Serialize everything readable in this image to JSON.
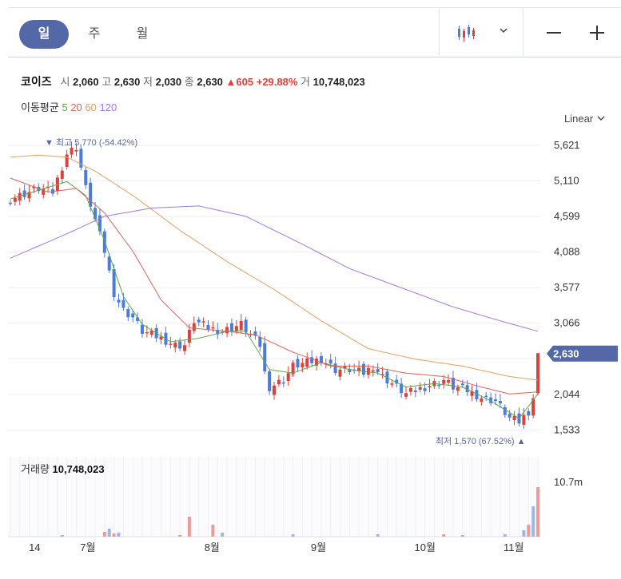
{
  "periods": [
    {
      "label": "일",
      "active": true
    },
    {
      "label": "주",
      "active": false
    },
    {
      "label": "월",
      "active": false
    }
  ],
  "toolbar": {
    "chart_type_icon": "candlestick-icon",
    "dropdown_icon": "chevron-down-icon",
    "zoom_out_icon": "minus-icon",
    "zoom_in_icon": "plus-icon"
  },
  "stock": {
    "name": "코이즈",
    "open_label": "시",
    "open": "2,060",
    "high_label": "고",
    "high": "2,630",
    "low_label": "저",
    "low": "2,030",
    "close_label": "종",
    "close": "2,630",
    "change": "▲605",
    "change_pct": "+29.88%",
    "volume_label": "거",
    "volume": "10,748,023"
  },
  "ma": {
    "label": "이동평균",
    "periods": [
      "5",
      "20",
      "60",
      "120"
    ],
    "colors": [
      "#5aa845",
      "#e0635a",
      "#e6a060",
      "#a577e6"
    ]
  },
  "scale": {
    "label": "Linear",
    "icon": "chevron-down-icon"
  },
  "volume_panel": {
    "label": "거래량",
    "value": "10,748,023",
    "axis_label": "10.7m"
  },
  "colors": {
    "up": "#e0403b",
    "down": "#4b7be0",
    "accent": "#5467a6",
    "grid": "#eeeeee"
  },
  "chart_data": {
    "type": "candlestick",
    "y_ticks": [
      5621,
      5110,
      4599,
      4088,
      3577,
      3066,
      2555,
      2044,
      1533
    ],
    "y_tick_labels": [
      "5,621",
      "5,110",
      "4,599",
      "4,088",
      "3,577",
      "3,066",
      "",
      "2,044",
      "1,533"
    ],
    "ylim": [
      1400,
      5700
    ],
    "current_price": 2630,
    "current_price_label": "2,630",
    "high_annotation": {
      "text": "최고 5,770 (-54.42%)",
      "value": 5770
    },
    "low_annotation": {
      "text": "최저 1,570 (67.52%)",
      "value": 1570
    },
    "x_labels": [
      "14",
      "7월",
      "8월",
      "9월",
      "10월",
      "11월"
    ],
    "close_anchors": [
      [
        0,
        4850
      ],
      [
        6,
        5000
      ],
      [
        9,
        4950
      ],
      [
        12,
        5500
      ],
      [
        14,
        5600
      ],
      [
        16,
        5000
      ],
      [
        18,
        4550
      ],
      [
        20,
        4100
      ],
      [
        22,
        3500
      ],
      [
        24,
        3250
      ],
      [
        26,
        3150
      ],
      [
        28,
        2950
      ],
      [
        32,
        2850
      ],
      [
        35,
        2750
      ],
      [
        37,
        2750
      ],
      [
        39,
        3100
      ],
      [
        42,
        3000
      ],
      [
        45,
        2950
      ],
      [
        49,
        3050
      ],
      [
        51,
        2900
      ],
      [
        53,
        2750
      ],
      [
        54,
        2350
      ],
      [
        55,
        2150
      ],
      [
        58,
        2250
      ],
      [
        60,
        2450
      ],
      [
        63,
        2500
      ],
      [
        66,
        2550
      ],
      [
        69,
        2400
      ],
      [
        72,
        2400
      ],
      [
        75,
        2350
      ],
      [
        77,
        2450
      ],
      [
        79,
        2300
      ],
      [
        81,
        2200
      ],
      [
        84,
        2050
      ],
      [
        86,
        2100
      ],
      [
        88,
        2150
      ],
      [
        90,
        2200
      ],
      [
        92,
        2250
      ],
      [
        94,
        2150
      ],
      [
        97,
        2100
      ],
      [
        100,
        2000
      ],
      [
        103,
        1950
      ],
      [
        106,
        1700
      ],
      [
        108,
        1650
      ],
      [
        110,
        1800
      ],
      [
        111,
        2000
      ],
      [
        112,
        2600
      ]
    ],
    "ma": {
      "5": [
        [
          0,
          4850
        ],
        [
          12,
          5100
        ],
        [
          16,
          4900
        ],
        [
          20,
          4250
        ],
        [
          24,
          3450
        ],
        [
          28,
          3050
        ],
        [
          34,
          2800
        ],
        [
          40,
          2850
        ],
        [
          46,
          2950
        ],
        [
          50,
          2950
        ],
        [
          55,
          2400
        ],
        [
          60,
          2350
        ],
        [
          66,
          2500
        ],
        [
          72,
          2400
        ],
        [
          78,
          2350
        ],
        [
          84,
          2150
        ],
        [
          90,
          2200
        ],
        [
          96,
          2150
        ],
        [
          102,
          1950
        ],
        [
          108,
          1700
        ],
        [
          112,
          2050
        ]
      ],
      "20": [
        [
          0,
          5150
        ],
        [
          8,
          4950
        ],
        [
          14,
          5000
        ],
        [
          20,
          4650
        ],
        [
          26,
          4100
        ],
        [
          32,
          3400
        ],
        [
          38,
          3000
        ],
        [
          46,
          2950
        ],
        [
          52,
          2900
        ],
        [
          60,
          2650
        ],
        [
          68,
          2450
        ],
        [
          76,
          2450
        ],
        [
          84,
          2350
        ],
        [
          92,
          2300
        ],
        [
          100,
          2150
        ],
        [
          106,
          2050
        ],
        [
          112,
          2080
        ]
      ],
      "60": [
        [
          0,
          5450
        ],
        [
          6,
          5480
        ],
        [
          12,
          5450
        ],
        [
          18,
          5250
        ],
        [
          26,
          4900
        ],
        [
          36,
          4400
        ],
        [
          46,
          3950
        ],
        [
          56,
          3550
        ],
        [
          66,
          3100
        ],
        [
          76,
          2700
        ],
        [
          86,
          2550
        ],
        [
          96,
          2450
        ],
        [
          106,
          2300
        ],
        [
          112,
          2250
        ]
      ],
      "120": [
        [
          0,
          4000
        ],
        [
          12,
          4350
        ],
        [
          20,
          4600
        ],
        [
          30,
          4720
        ],
        [
          40,
          4750
        ],
        [
          50,
          4600
        ],
        [
          62,
          4200
        ],
        [
          72,
          3850
        ],
        [
          82,
          3600
        ],
        [
          94,
          3300
        ],
        [
          104,
          3100
        ],
        [
          112,
          2950
        ]
      ]
    },
    "volume_bars": [
      [
        11,
        0.02,
        "down"
      ],
      [
        20,
        0.06,
        "up"
      ],
      [
        21,
        0.1,
        "down"
      ],
      [
        22,
        0.04,
        "up"
      ],
      [
        23,
        0.05,
        "down"
      ],
      [
        36,
        0.02,
        "up"
      ],
      [
        38,
        0.25,
        "up"
      ],
      [
        43,
        0.15,
        "up"
      ],
      [
        45,
        0.05,
        "down"
      ],
      [
        60,
        0.03,
        "down"
      ],
      [
        78,
        0.03,
        "down"
      ],
      [
        92,
        0.03,
        "up"
      ],
      [
        96,
        0.02,
        "up"
      ],
      [
        105,
        0.03,
        "down"
      ],
      [
        109,
        0.08,
        "down"
      ],
      [
        110,
        0.15,
        "up"
      ],
      [
        111,
        0.38,
        "down"
      ],
      [
        112,
        0.62,
        "up"
      ]
    ]
  }
}
